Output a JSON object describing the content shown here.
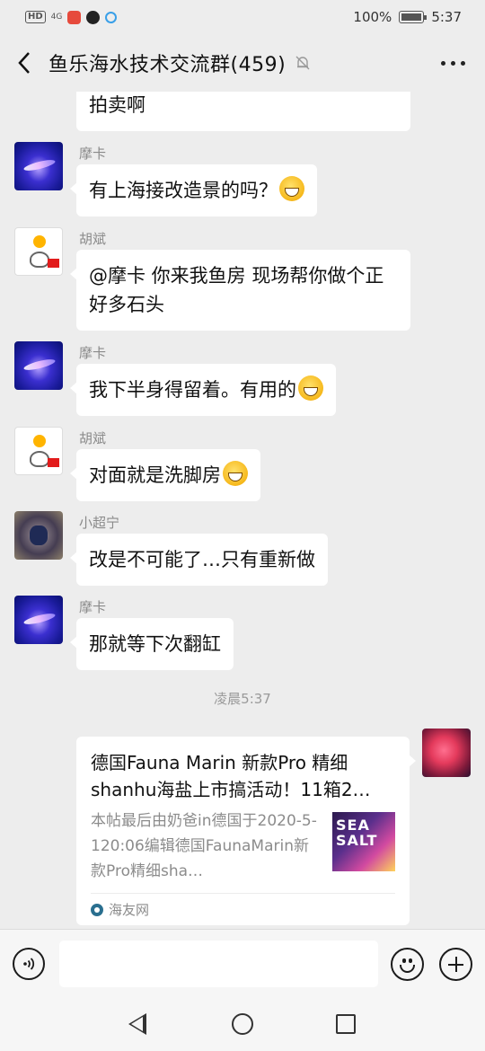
{
  "status_bar": {
    "network": "4G",
    "battery_percent": "100%",
    "time": "5:37"
  },
  "header": {
    "title": "鱼乐海水技术交流群(459)"
  },
  "messages": [
    {
      "sender": "",
      "text": "拍卖啊"
    },
    {
      "sender": "摩卡",
      "text": "有上海接改造景的吗？",
      "emoji": "grin"
    },
    {
      "sender": "胡斌",
      "text": "@摩卡  你来我鱼房 现场帮你做个正好多石头"
    },
    {
      "sender": "摩卡",
      "text": "我下半身得留着。有用的",
      "emoji": "grimace"
    },
    {
      "sender": "胡斌",
      "text": "对面就是洗脚房",
      "emoji": "joy"
    },
    {
      "sender": "小超宁",
      "text": "改是不可能了…只有重新做"
    },
    {
      "sender": "摩卡",
      "text": "那就等下次翻缸"
    }
  ],
  "timestamp": "凌晨5:37",
  "shared_card": {
    "title": "德国Fauna Marin 新款Pro 精细shanhu海盐上市搞活动！11箱2…",
    "description": "本帖最后由奶爸in德国于2020-5-120:06编辑德国FaunaMarin新款Pro精细sha…",
    "thumbnail_text": "SEA SALT",
    "source": "海友网"
  },
  "input": {
    "value": "",
    "placeholder": ""
  }
}
